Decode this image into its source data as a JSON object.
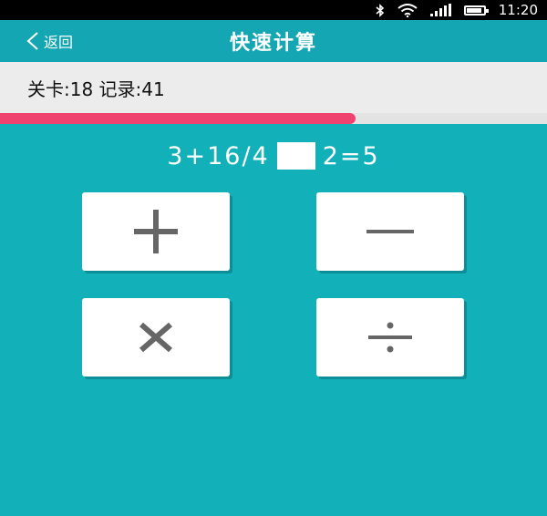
{
  "status_bar": {
    "time": "11:20",
    "icons": [
      "bluetooth-icon",
      "wifi-icon",
      "signal-icon",
      "battery-icon"
    ],
    "battery_level": 0.9
  },
  "header": {
    "back_label": "返回",
    "title": "快速计算"
  },
  "info": {
    "text": "关卡:18 记录:41"
  },
  "progress": {
    "value": 0.65,
    "color": "#f0426e",
    "track_color": "#e3e3e3"
  },
  "question": {
    "left": "3+16/4",
    "right": "2=5"
  },
  "operators": [
    {
      "name": "plus",
      "icon": "plus-icon"
    },
    {
      "name": "minus",
      "icon": "minus-icon"
    },
    {
      "name": "multiply",
      "icon": "multiply-icon"
    },
    {
      "name": "divide",
      "icon": "divide-icon"
    }
  ],
  "colors": {
    "background": "#12b0b8",
    "header": "#14a6b3",
    "operator_glyph": "#666666"
  }
}
